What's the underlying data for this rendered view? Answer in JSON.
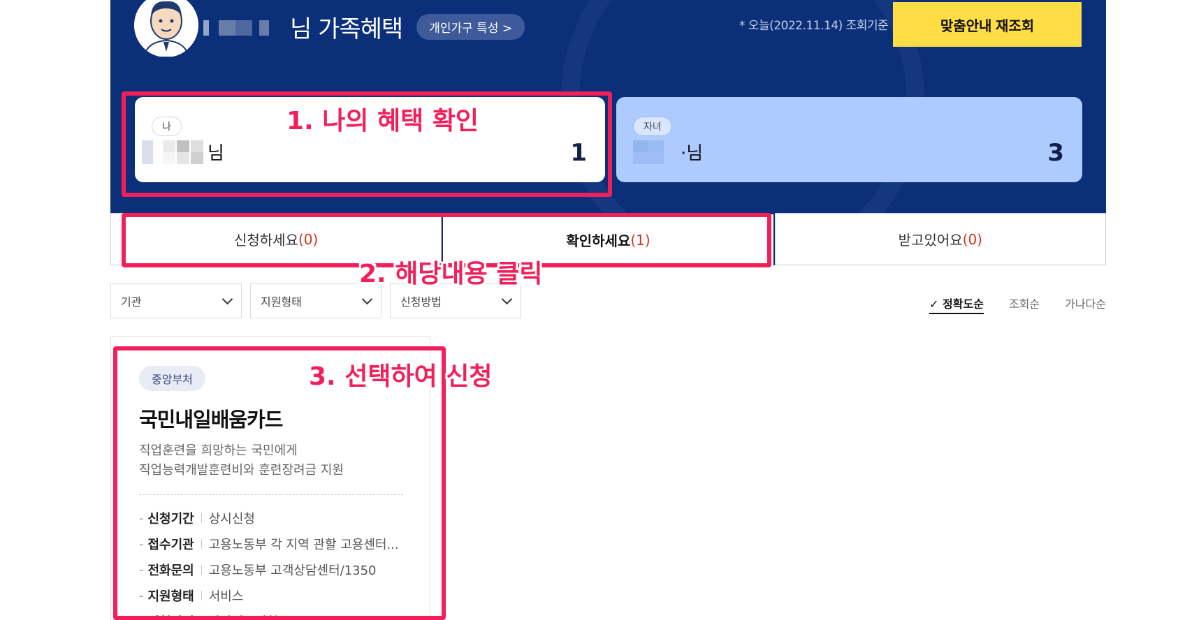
{
  "header": {
    "title_suffix": "님 가족혜택",
    "household_pill": "개인가구 특성 >",
    "query_date_note": "* 오늘(2022.11.14) 조회기준",
    "requery_button": "맞춤안내 재조회",
    "bg_color": "#0c2f7a"
  },
  "members": [
    {
      "chip": "나",
      "suffix": "님",
      "count": "1"
    },
    {
      "chip": "자녀",
      "suffix": "·님",
      "count": "3"
    }
  ],
  "tabs": [
    {
      "label": "신청하세요",
      "count": "(0)"
    },
    {
      "label": "확인하세요",
      "count": "(1)"
    },
    {
      "label": "받고있어요",
      "count": "(0)"
    }
  ],
  "filters": [
    "기관",
    "지원형태",
    "신청방법"
  ],
  "sorts": [
    "✓ 정확도순",
    "조회순",
    "가나다순"
  ],
  "benefit": {
    "agency": "중앙부처",
    "title": "국민내일배움카드",
    "desc_line1": "직업훈련을 희망하는 국민에게",
    "desc_line2": "직업능력개발훈련비와 훈련장려금 지원",
    "rows": [
      {
        "key": "신청기간",
        "value": "상시신청"
      },
      {
        "key": "접수기관",
        "value": "고용노동부 각 지역 관할 고용센터..."
      },
      {
        "key": "전화문의",
        "value": "고용노동부 고객상담센터/1350"
      },
      {
        "key": "지원형태",
        "value": "서비스"
      },
      {
        "key": "신청방법",
        "value": "타사이트신청"
      }
    ]
  },
  "annotations": {
    "step1": "1. 나의 혜택 확인",
    "step2": "2. 해당내용 클릭",
    "step3": "3. 선택하여 신청",
    "color": "#f2205a"
  }
}
